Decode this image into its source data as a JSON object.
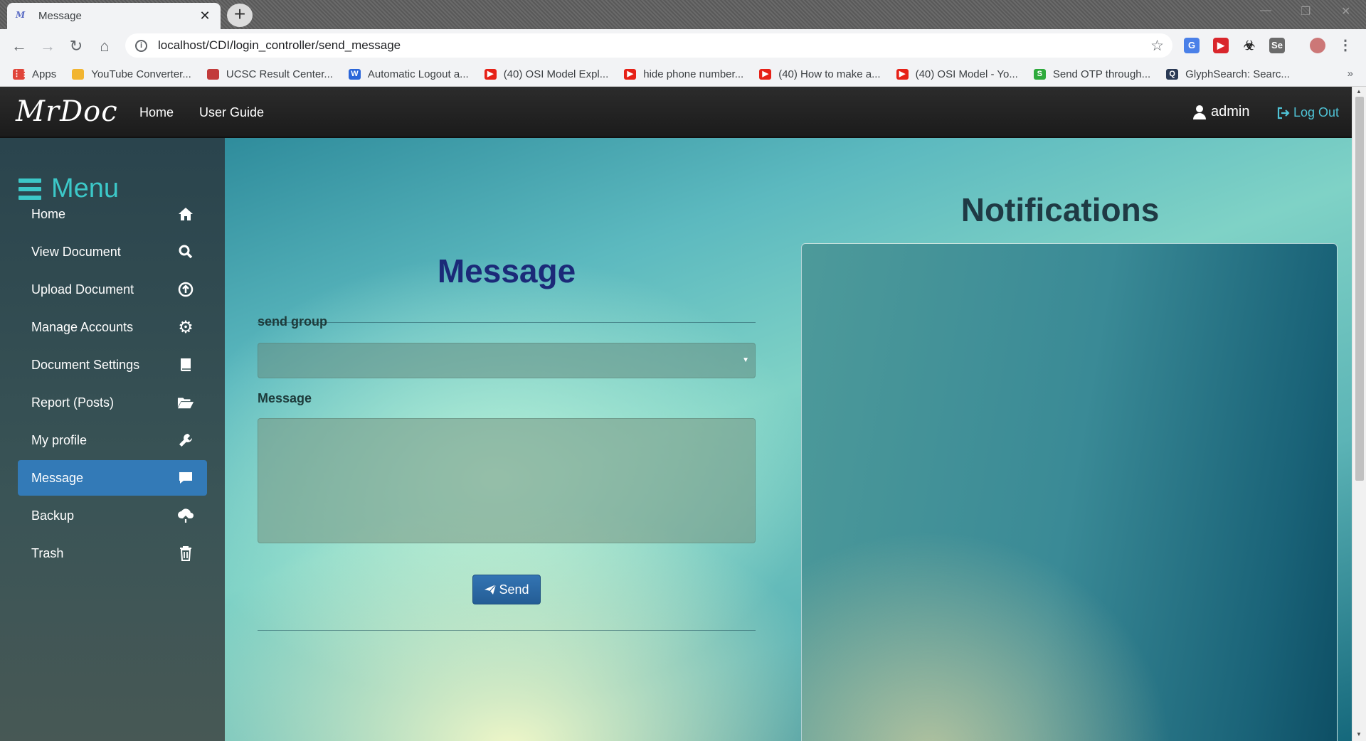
{
  "browser": {
    "tab_title": "Message",
    "url": "localhost/CDI/login_controller/send_message",
    "bookmarks": [
      {
        "label": "Apps",
        "icon": "apps-grid-icon",
        "color": "#e0453a"
      },
      {
        "label": "YouTube Converter...",
        "icon": "youtube-converter-icon",
        "color": "#f2b531"
      },
      {
        "label": "UCSC Result Center...",
        "icon": "ucsc-icon",
        "color": "#c23b3b"
      },
      {
        "label": "Automatic Logout a...",
        "icon": "word-w-icon",
        "color": "#2b66d9"
      },
      {
        "label": "(40) OSI Model Expl...",
        "icon": "youtube-icon",
        "color": "#e62117"
      },
      {
        "label": "hide phone number...",
        "icon": "youtube-icon",
        "color": "#e62117"
      },
      {
        "label": "(40) How to make a...",
        "icon": "youtube-icon",
        "color": "#e62117"
      },
      {
        "label": "(40) OSI Model - Yo...",
        "icon": "youtube-icon",
        "color": "#e62117"
      },
      {
        "label": "Send OTP through...",
        "icon": "s-green-icon",
        "color": "#2eaa3c"
      },
      {
        "label": "GlyphSearch: Searc...",
        "icon": "glyphsearch-icon",
        "color": "#2b3a55"
      }
    ]
  },
  "app": {
    "brand": "MrDoc",
    "nav": {
      "home": "Home",
      "user_guide": "User Guide"
    },
    "user": "admin",
    "logout": "Log Out",
    "colors": {
      "accent": "#3cc8c8",
      "active_item": "#337ab7",
      "logout": "#4fc3d6",
      "title": "#1b2a78"
    }
  },
  "sidebar": {
    "title": "Menu",
    "items": [
      {
        "label": "Home",
        "icon": "home-icon"
      },
      {
        "label": "View Document",
        "icon": "search-icon"
      },
      {
        "label": "Upload Document",
        "icon": "upload-circle-icon"
      },
      {
        "label": "Manage Accounts",
        "icon": "gear-icon"
      },
      {
        "label": "Document Settings",
        "icon": "book-icon"
      },
      {
        "label": "Report (Posts)",
        "icon": "folder-open-icon"
      },
      {
        "label": "My profile",
        "icon": "wrench-icon"
      },
      {
        "label": "Message",
        "icon": "comment-icon",
        "active": true
      },
      {
        "label": "Backup",
        "icon": "cloud-upload-icon"
      },
      {
        "label": "Trash",
        "icon": "trash-icon"
      }
    ]
  },
  "form": {
    "title": "Message",
    "group_label": "send group",
    "group_value": "",
    "message_label": "Message",
    "message_value": "",
    "send_label": "Send"
  },
  "notifications": {
    "title": "Notifications"
  }
}
